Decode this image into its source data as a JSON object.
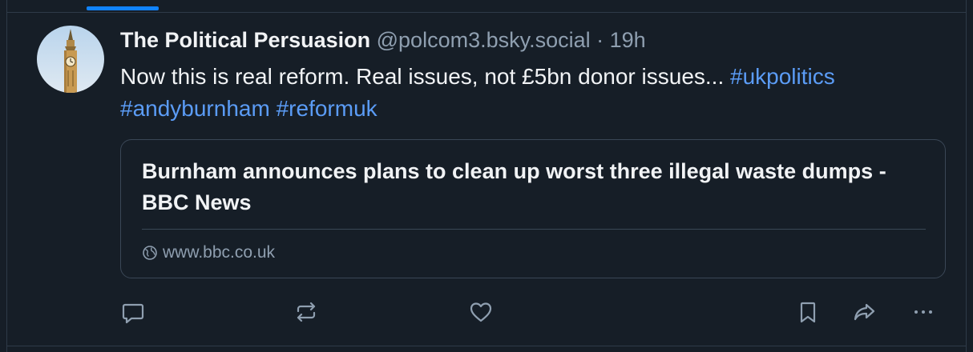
{
  "post": {
    "author_name": "The Political Persuasion",
    "handle": "@polcom3.bsky.social",
    "separator": " · ",
    "timestamp": "19h",
    "text_plain": "Now this is real reform. Real issues, not £5bn donor issues... ",
    "hashtags": [
      "#ukpolitics",
      "#andyburnham",
      "#reformuk"
    ]
  },
  "link_card": {
    "title": "Burnham announces plans to clean up worst three illegal waste dumps - BBC News",
    "domain": "www.bbc.co.uk"
  },
  "colors": {
    "background": "#161e27",
    "accent": "#1083fe",
    "link": "#5b9cf6",
    "muted": "#8f9fb0"
  },
  "icons": [
    "avatar-big-ben",
    "globe-icon",
    "reply-icon",
    "repost-icon",
    "like-icon",
    "bookmark-icon",
    "share-icon",
    "more-icon"
  ]
}
